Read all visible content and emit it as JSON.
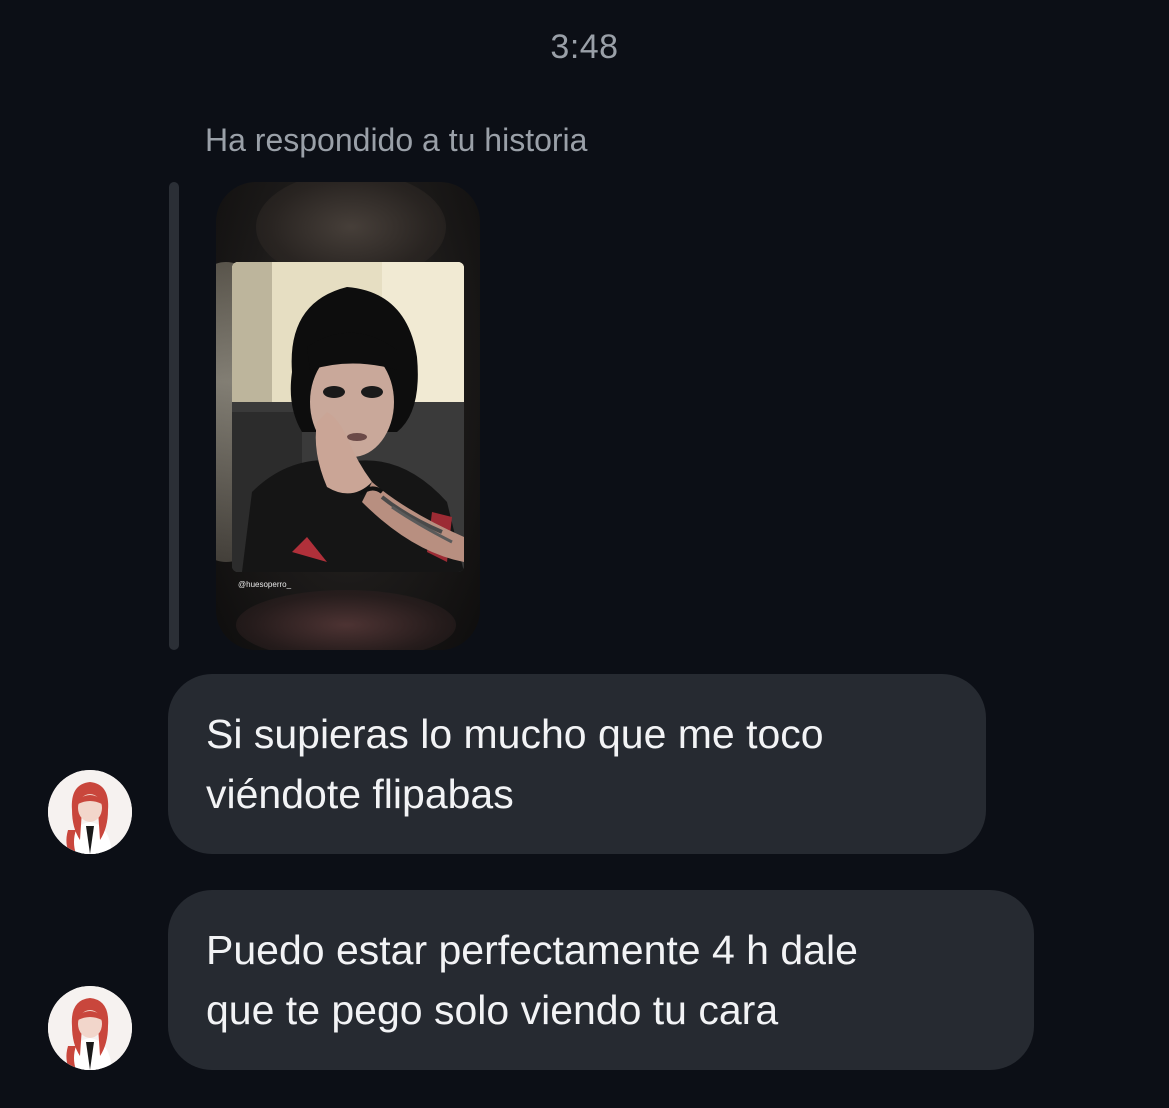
{
  "timestamp": "3:48",
  "reply_note": "Ha respondido a tu historia",
  "story": {
    "handle": "@huesoperro_"
  },
  "messages": [
    {
      "lines": [
        "Si supieras lo mucho que me toco",
        "viéndote flipabas"
      ]
    },
    {
      "lines": [
        "Puedo estar perfectamente 4 h dale",
        "que te pego solo viendo tu cara"
      ]
    }
  ],
  "colors": {
    "background": "#0c0f16",
    "bubble": "#262a31",
    "text": "#f2f3f5",
    "muted_text": "#9aa0a8"
  }
}
